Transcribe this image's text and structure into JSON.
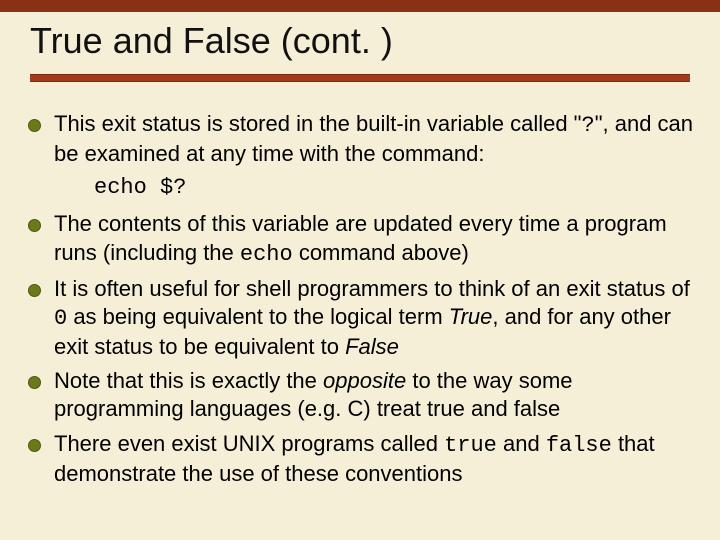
{
  "title": "True and False (cont. )",
  "bullets": {
    "b1_pre": "This exit status is stored in the built-in variable called \"",
    "b1_q": "?",
    "b1_post": "\", and can be examined at any time with the command:",
    "code1": "echo $?",
    "b2_pre": "The contents of this variable are updated every time a program runs (including the ",
    "b2_code": "echo",
    "b2_post": " command above)",
    "b3_pre": "It is often useful for shell programmers to think of an exit status of ",
    "b3_code": "0",
    "b3_mid": " as being equivalent to the logical term ",
    "b3_true": "True",
    "b3_mid2": ", and for any other exit status to be equivalent to ",
    "b3_false": "False",
    "b4_pre": "Note that this is exactly the ",
    "b4_opp": "opposite",
    "b4_post": " to the way some programming languages (e.g. C) treat true and false",
    "b5_pre": "There even exist UNIX programs called ",
    "b5_c1": "true",
    "b5_mid": " and ",
    "b5_c2": "false",
    "b5_post": " that demonstrate the use of these conventions"
  }
}
